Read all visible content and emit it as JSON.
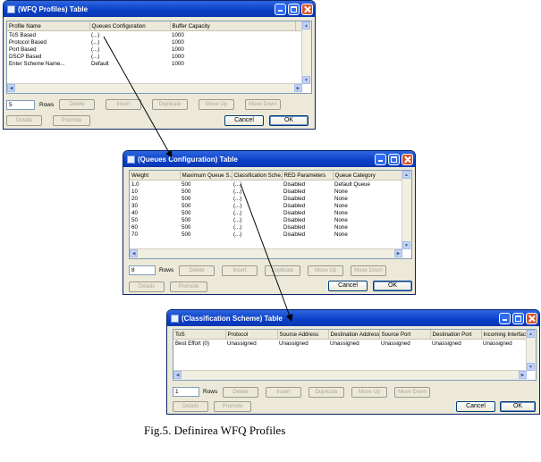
{
  "wfq_window": {
    "title": "(WFQ Profiles) Table",
    "columns": [
      "Profile Name",
      "Queues Configuration",
      "Buffer Capacity"
    ],
    "rows": [
      [
        "ToS Based",
        "(...)",
        "1000"
      ],
      [
        "Protocol Based",
        "(...)",
        "1000"
      ],
      [
        "Port Based",
        "(...)",
        "1000"
      ],
      [
        "DSCP Based",
        "(...)",
        "1000"
      ],
      [
        "Enter Scheme Name...",
        "Default",
        "1000"
      ]
    ],
    "rows_value": "5",
    "rows_label": "Rows",
    "buttons": [
      "Delete",
      "Insert",
      "Duplicate",
      "Move Up",
      "Move Down"
    ],
    "buttons2": [
      "Details",
      "Promote"
    ],
    "cancel": "Cancel",
    "ok": "OK"
  },
  "queues_window": {
    "title": "(Queues Configuration) Table",
    "columns": [
      "Weight",
      "Maximum Queue S...",
      "Classification Sche...",
      "RED Parameters",
      "Queue Category"
    ],
    "rows": [
      [
        "1.0",
        "500",
        "(...)",
        "Disabled",
        "Default Queue"
      ],
      [
        "10",
        "500",
        "(...)",
        "Disabled",
        "None"
      ],
      [
        "20",
        "500",
        "(...)",
        "Disabled",
        "None"
      ],
      [
        "30",
        "500",
        "(...)",
        "Disabled",
        "None"
      ],
      [
        "40",
        "500",
        "(...)",
        "Disabled",
        "None"
      ],
      [
        "50",
        "500",
        "(...)",
        "Disabled",
        "None"
      ],
      [
        "60",
        "500",
        "(...)",
        "Disabled",
        "None"
      ],
      [
        "70",
        "500",
        "(...)",
        "Disabled",
        "None"
      ]
    ],
    "rows_value": "8",
    "rows_label": "Rows",
    "buttons": [
      "Delete",
      "Insert",
      "Duplicate",
      "Move Up",
      "Move Down"
    ],
    "buttons2": [
      "Details",
      "Promote"
    ],
    "cancel": "Cancel",
    "ok": "OK"
  },
  "classification_window": {
    "title": "(Classification Scheme) Table",
    "columns": [
      "ToS",
      "Protocol",
      "Source Address",
      "Destination Address",
      "Source Port",
      "Destination Port",
      "Incoming Interface"
    ],
    "rows": [
      [
        "Best Effort (0)",
        "Unassigned",
        "Unassigned",
        "Unassigned",
        "Unassigned",
        "Unassigned",
        "Unassigned"
      ]
    ],
    "rows_value": "1",
    "rows_label": "Rows",
    "buttons": [
      "Delete",
      "Insert",
      "Duplicate",
      "Move Up",
      "Move Down"
    ],
    "buttons2": [
      "Details",
      "Promote"
    ],
    "cancel": "Cancel",
    "ok": "OK"
  },
  "caption": "Fig.5. Definirea WFQ Profiles",
  "colors": {
    "title_bar": "#0a3fc6",
    "window_bg": "#ece9d8",
    "close_button": "#d9542b"
  }
}
